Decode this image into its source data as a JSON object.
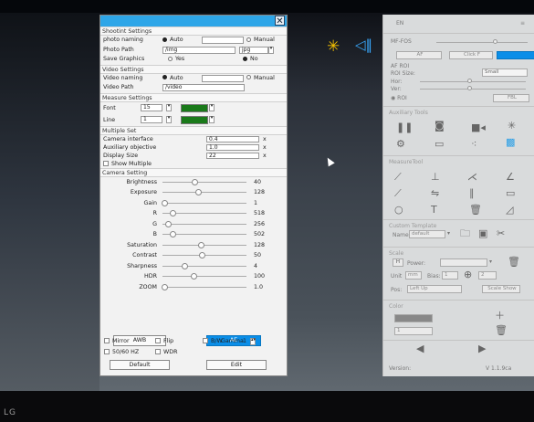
{
  "desktop": {
    "brand": "LG",
    "accent_colors": {
      "title_bar": "#2ea6e8",
      "active_button": "#0a8ee8",
      "swatch": "#1a7a1a"
    }
  },
  "dialog": {
    "shooting": {
      "header": "Shootint Settings",
      "photo_naming_label": "photo naming",
      "auto": "Auto",
      "manual": "Manual",
      "photo_path_label": "Photo Path",
      "photo_path": "/img",
      "format": "jpg",
      "save_graphics_label": "Save Graphics",
      "yes": "Yes",
      "no": "No"
    },
    "video": {
      "header": "Video Settings",
      "naming_label": "Video naming",
      "auto": "Auto",
      "manual": "Manual",
      "path_label": "Video Path",
      "path": "/video"
    },
    "measure": {
      "header": "Measure Settings",
      "font_label": "Font",
      "font_value": "15",
      "line_label": "Line",
      "line_value": "1"
    },
    "multiple": {
      "header": "Multiple Set",
      "camera_interface_label": "Camera interface",
      "camera_interface": "0.4",
      "aux_label": "Auxiliary objective",
      "aux": "1.0",
      "display_size_label": "Display Size",
      "display_size": "22",
      "x": "x",
      "show_multiple": "Show Multiple"
    },
    "camera": {
      "header": "Camera Setting",
      "sliders": [
        {
          "label": "Brightness",
          "value": "40",
          "pos": 0.38
        },
        {
          "label": "Exposure",
          "value": "128",
          "pos": 0.42
        },
        {
          "label": "Gain",
          "value": "1",
          "pos": 0.02
        },
        {
          "label": "R",
          "value": "518",
          "pos": 0.12
        },
        {
          "label": "G",
          "value": "256",
          "pos": 0.06
        },
        {
          "label": "B",
          "value": "502",
          "pos": 0.12
        },
        {
          "label": "Saturation",
          "value": "128",
          "pos": 0.46
        },
        {
          "label": "Contrast",
          "value": "50",
          "pos": 0.47
        },
        {
          "label": "Sharpness",
          "value": "4",
          "pos": 0.26
        },
        {
          "label": "HDR",
          "value": "100",
          "pos": 0.37
        },
        {
          "label": "ZOOM",
          "value": "1.0",
          "pos": 0.02
        }
      ],
      "awb": "AWB",
      "ae": "AE",
      "mirror": "Mirror",
      "flip": "Flip",
      "bw": "B/W",
      "gamma_label": "Gamma",
      "gamma": "1",
      "hz": "50/60 HZ",
      "wdr": "WDR",
      "default": "Default",
      "edit": "Edit"
    }
  },
  "right_panel": {
    "top_label": "EN",
    "mf_fos": "MF-FOS",
    "af": "AF",
    "click_f": "Click F",
    "af_roi": "AF ROI",
    "roi_size": "ROI Size:",
    "roi_size_value": "Small",
    "hor": "Hor:",
    "ver": "Ver:",
    "roi": "ROI",
    "fbl": "FBL",
    "auxiliary_tools": "Auxiliary Tools",
    "measure_tool": "MeasureTool",
    "custom_template": "Custom Template",
    "name_label": "Name",
    "name_value": "default",
    "scale": "Scale",
    "h": "H",
    "power": "Power:",
    "unit": "Unit",
    "unit_value": "mm",
    "bias": "Bias:",
    "bias_value": "1",
    "zoom_value": "2",
    "pos": "Pos:",
    "pos_value": "Left Up",
    "scale_show": "Scale Show",
    "color": "Color",
    "one": "1",
    "version_label": "Version:",
    "version": "V 1.1.9ca"
  }
}
